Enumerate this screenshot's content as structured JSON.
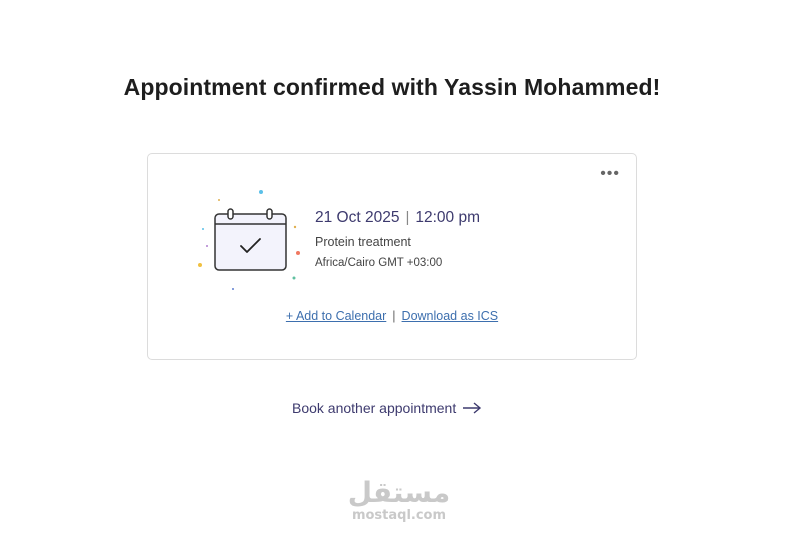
{
  "header": {
    "title": "Appointment confirmed with Yassin Mohammed!"
  },
  "card": {
    "more_icon": "more-horizontal-icon",
    "date": "21 Oct 2025",
    "separator": "|",
    "time": "12:00 pm",
    "service": "Protein treatment",
    "timezone": "Africa/Cairo GMT +03:00",
    "add_to_calendar": "+ Add to Calendar",
    "link_separator": "|",
    "download_ics": "Download as ICS"
  },
  "book_another": {
    "label": "Book another appointment",
    "icon": "arrow-right-icon"
  },
  "watermark": {
    "arabic": "مستقل",
    "latin": "mostaql.com"
  },
  "colors": {
    "accent_text": "#3d3a6e",
    "link": "#3d6fae",
    "border": "#dcdcdc",
    "calendar_fill": "#f3f3fc"
  }
}
